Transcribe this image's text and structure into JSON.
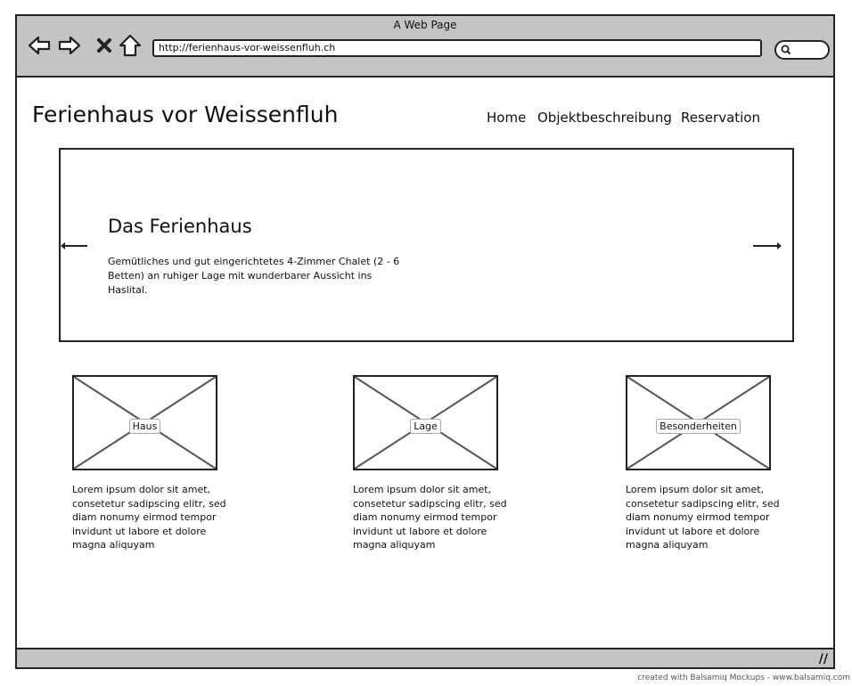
{
  "browser": {
    "window_title": "A Web Page",
    "url": "http://ferienhaus-vor-weissenfluh.ch",
    "credit": "created with Balsamiq Mockups - www.balsamiq.com"
  },
  "site": {
    "title": "Ferienhaus vor Weissenfluh",
    "nav": [
      "Home",
      "Objektbeschreibung",
      "Reservation"
    ]
  },
  "hero": {
    "heading": "Das Ferienhaus",
    "text": "Gemütliches und gut eingerichtetes 4-Zimmer Chalet (2 - 6 Betten) an ruhiger Lage mit wunderbarer Aussicht ins Haslital."
  },
  "cards": [
    {
      "image_label": "Haus",
      "text": "Lorem ipsum dolor sit amet, consetetur sadipscing elitr, sed diam nonumy eirmod tempor invidunt ut labore et dolore magna aliquyam"
    },
    {
      "image_label": "Lage",
      "text": "Lorem ipsum dolor sit amet, consetetur sadipscing elitr, sed diam nonumy eirmod tempor invidunt ut labore et dolore magna aliquyam"
    },
    {
      "image_label": "Besonderheiten",
      "text": "Lorem ipsum dolor sit amet, consetetur sadipscing elitr, sed diam nonumy eirmod tempor invidunt ut labore et dolore magna aliquyam"
    }
  ]
}
